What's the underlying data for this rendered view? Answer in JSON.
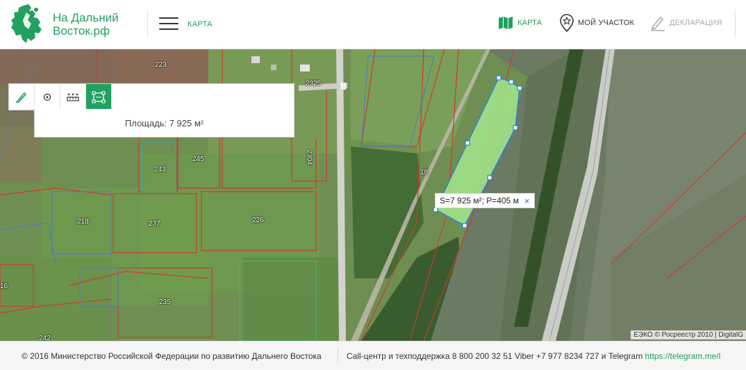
{
  "header": {
    "logo_line1": "На Дальний",
    "logo_line2": "Восток.рф",
    "menu_label": "КАРТА",
    "nav": [
      {
        "label": "КАРТА",
        "icon": "map-icon",
        "active": true
      },
      {
        "label": "МОЙ УЧАСТОК",
        "icon": "star-pin-icon",
        "active": false
      },
      {
        "label": "ДЕКЛАРАЦИЯ",
        "icon": "pencil-icon",
        "active": false
      }
    ]
  },
  "toolbar": {
    "tools": [
      {
        "icon": "ruler-pencil-icon",
        "active": false
      },
      {
        "icon": "point-icon",
        "active": false
      },
      {
        "icon": "distance-icon",
        "active": false
      },
      {
        "icon": "area-measure-icon",
        "active": true
      }
    ],
    "area_text": "Площадь: 7 925 м²"
  },
  "measurement": {
    "label": "S=7 925 м²; P=405 м",
    "close": "×"
  },
  "map": {
    "parcels": [
      "223",
      "2325",
      "245",
      "243",
      "2304",
      "18",
      "218",
      "237",
      "226",
      "16",
      "235",
      "242"
    ],
    "attribution": "ЕЭКО © Росреестр 2010 | DigitalG"
  },
  "footer": {
    "copyright": "© 2016 Министерство Российской Федерации по развитию Дальнего Востока",
    "contacts_text": "Call-центр и техподдержка 8 800 200 32 51   Viber +7 977 8234 727 и Telegram ",
    "telegram_link": "https://telegram.me/l"
  },
  "colors": {
    "brand": "#22a060",
    "selection_fill": "#a8ef90",
    "parcel_border": "#d23a2a"
  }
}
